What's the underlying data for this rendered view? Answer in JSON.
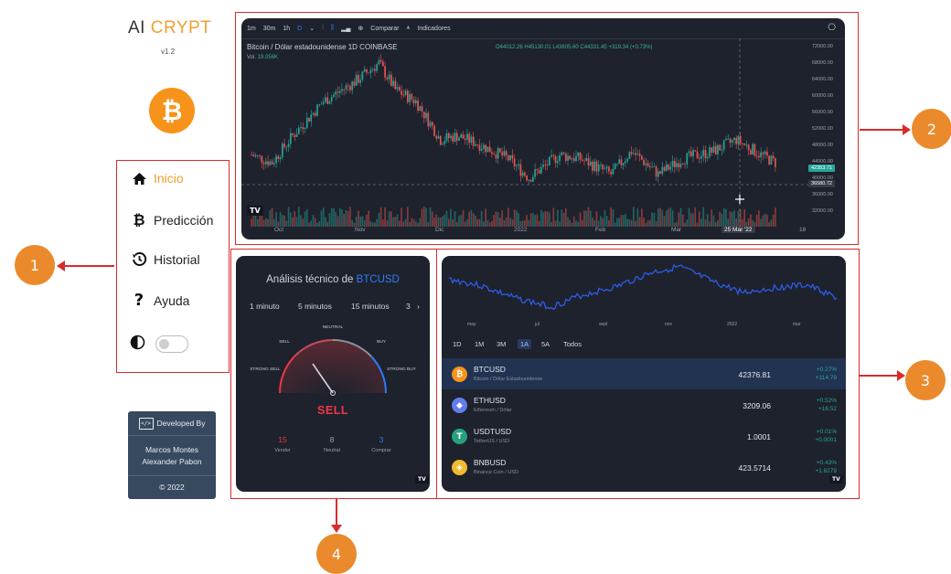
{
  "sidebar": {
    "logo_main": "AI",
    "logo_accent": "CRYPT",
    "version": "v1.2",
    "logo_icon": "bitcoin-icon",
    "nav": [
      {
        "label": "Inicio",
        "icon": "home-icon",
        "active": true
      },
      {
        "label": "Predicción",
        "icon": "bitcoin-icon"
      },
      {
        "label": "Historial",
        "icon": "history-icon"
      },
      {
        "label": "Ayuda",
        "icon": "question-icon"
      }
    ],
    "theme_toggle_icon": "contrast-icon",
    "developer": {
      "title": "Developed By",
      "name1": "Marcos Montes",
      "name2": "Alexander Pabon",
      "year": "© 2022"
    }
  },
  "callouts": [
    "1",
    "2",
    "3",
    "4"
  ],
  "main_chart": {
    "toolbar": [
      "1m",
      "30m",
      "1h",
      "D",
      "Comparar",
      "Indicadores"
    ],
    "symbol": "Bitcoin / Dólar estadounidense  1D  COINBASE",
    "ohlc": "O44012.26 H45130.01 L43605.60 C44331.45 +319.34 (+0.73%)",
    "vol_label": "Vol.",
    "vol_value": "19.056K",
    "y_ticks": [
      "72000.00",
      "68000.00",
      "64000.00",
      "60000.00",
      "56000.00",
      "52000.00",
      "48000.00",
      "44000.00",
      "40000.00",
      "36000.00",
      "32000.00"
    ],
    "price_tag_1": "42353.71",
    "price_tag_2": "36580.72",
    "x_ticks": [
      "Oct",
      "Nov",
      "Dic",
      "2022",
      "Feb",
      "Mar",
      "25 Mar '22",
      "18"
    ],
    "colors": {
      "up": "#26a69a",
      "down": "#ef5350",
      "bg": "#1e222d"
    }
  },
  "technical": {
    "title_prefix": "Análisis técnico de",
    "title_symbol": "BTCUSD",
    "timeframes": [
      "1 minuto",
      "5 minutos",
      "15 minutos",
      "3"
    ],
    "more": "›",
    "gauge_labels": {
      "strong_sell": "STRONG SELL",
      "sell": "SELL",
      "neutral": "NEUTRAL",
      "buy": "BUY",
      "strong_buy": "STRONG BUY"
    },
    "result": "SELL",
    "counts": [
      {
        "value": "15",
        "label": "Vender"
      },
      {
        "value": "8",
        "label": "Neutral"
      },
      {
        "value": "3",
        "label": "Comprar"
      }
    ]
  },
  "market": {
    "mini_x": [
      "may",
      "jul",
      "sept",
      "nov",
      "2022",
      "mar"
    ],
    "ranges": [
      "1D",
      "1M",
      "3M",
      "1A",
      "5A",
      "Todos"
    ],
    "selected_range": "1A",
    "rows": [
      {
        "ticker": "BTCUSD",
        "desc": "Bitcoin / Dólar Estadounidense",
        "price": "42376.81",
        "pct": "+0.27%",
        "abs": "+114.79",
        "color": "#f7931a",
        "icon": "₿"
      },
      {
        "ticker": "ETHUSD",
        "desc": "Ethereum / Dólar",
        "price": "3209.06",
        "pct": "+0.52%",
        "abs": "+16.52",
        "color": "#627eea",
        "icon": "◆"
      },
      {
        "ticker": "USDTUSD",
        "desc": "TetherUS / USD",
        "price": "1.0001",
        "pct": "+0.01%",
        "abs": "+0.0001",
        "color": "#26a17b",
        "icon": "T"
      },
      {
        "ticker": "BNBUSD",
        "desc": "Binance Coin / USD",
        "price": "423.5714",
        "pct": "+0.43%",
        "abs": "+1.8279",
        "color": "#f3ba2f",
        "icon": "◈"
      }
    ]
  }
}
